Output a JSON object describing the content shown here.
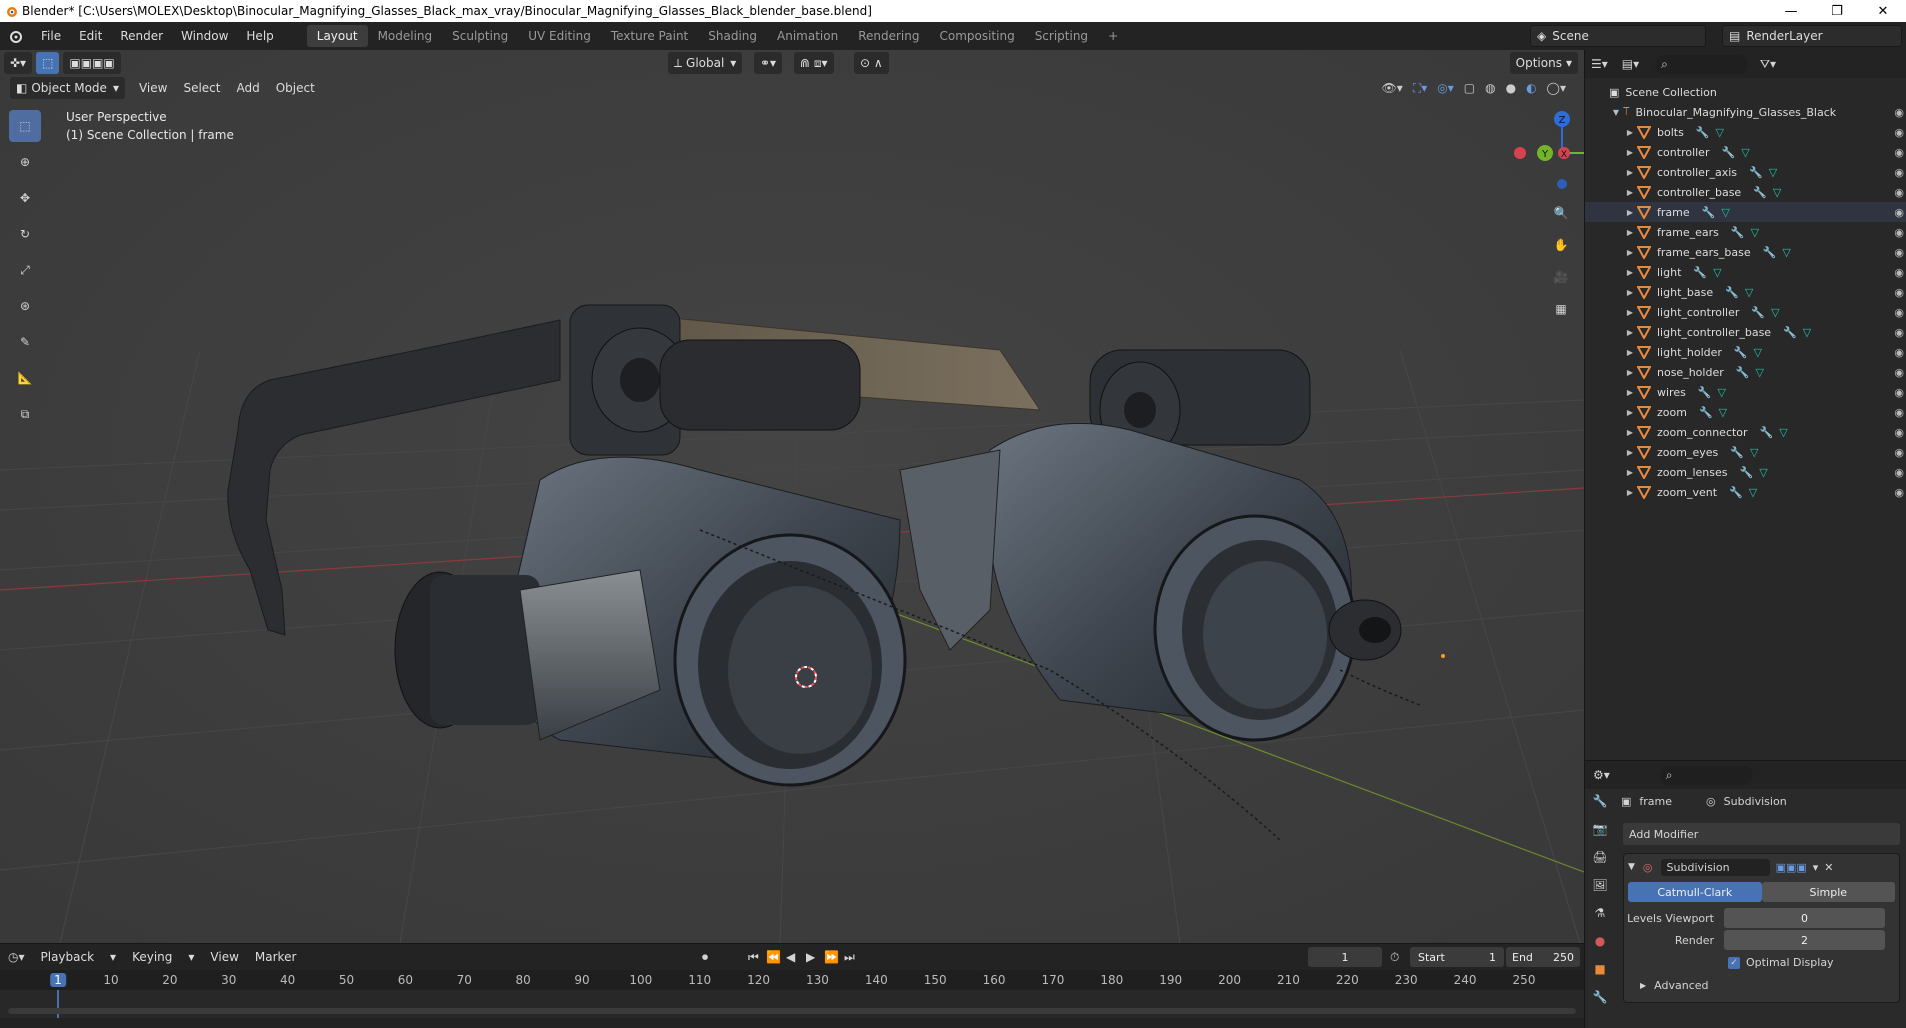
{
  "window": {
    "title": "Blender* [C:\\Users\\MOLEX\\Desktop\\Binocular_Magnifying_Glasses_Black_max_vray/Binocular_Magnifying_Glasses_Black_blender_base.blend]"
  },
  "menubar": {
    "items": [
      "File",
      "Edit",
      "Render",
      "Window",
      "Help"
    ]
  },
  "workspaces": [
    {
      "label": "Layout",
      "active": true
    },
    {
      "label": "Modeling"
    },
    {
      "label": "Sculpting"
    },
    {
      "label": "UV Editing"
    },
    {
      "label": "Texture Paint"
    },
    {
      "label": "Shading"
    },
    {
      "label": "Animation"
    },
    {
      "label": "Rendering"
    },
    {
      "label": "Compositing"
    },
    {
      "label": "Scripting"
    }
  ],
  "scene": {
    "scene_name": "Scene",
    "view_layer": "RenderLayer"
  },
  "viewport": {
    "mode": "Object Mode",
    "menus": [
      "View",
      "Select",
      "Add",
      "Object"
    ],
    "transform_orientation": "Global",
    "options_label": "Options",
    "overlay_line1": "User Perspective",
    "overlay_line2": "(1) Scene Collection | frame"
  },
  "outliner": {
    "root": "Scene Collection",
    "collection": "Binocular_Magnifying_Glasses_Black",
    "objects": [
      "bolts",
      "controller",
      "controller_axis",
      "controller_base",
      "frame",
      "frame_ears",
      "frame_ears_base",
      "light",
      "light_base",
      "light_controller",
      "light_controller_base",
      "light_holder",
      "nose_holder",
      "wires",
      "zoom",
      "zoom_connector",
      "zoom_eyes",
      "zoom_lenses",
      "zoom_vent"
    ]
  },
  "properties": {
    "object": "frame",
    "modifier_crumb": "Subdivision",
    "add_modifier": "Add Modifier",
    "modifier_name": "Subdivision",
    "type_a": "Catmull-Clark",
    "type_b": "Simple",
    "levels_viewport_label": "Levels Viewport",
    "levels_viewport": "0",
    "render_label": "Render",
    "render": "2",
    "optimal_display": "Optimal Display",
    "advanced": "Advanced"
  },
  "timeline": {
    "menus": [
      "Playback",
      "Keying",
      "View",
      "Marker"
    ],
    "current_frame": "1",
    "start_label": "Start",
    "start": "1",
    "end_label": "End",
    "end": "250",
    "ruler": [
      "1",
      "10",
      "20",
      "30",
      "40",
      "50",
      "60",
      "70",
      "80",
      "90",
      "100",
      "110",
      "120",
      "130",
      "140",
      "150",
      "160",
      "170",
      "180",
      "190",
      "200",
      "210",
      "220",
      "230",
      "240",
      "250"
    ]
  },
  "colors": {
    "accent": "#4772b3",
    "mesh_icon": "#e88a3c",
    "modifier_icon": "#6a8fe0",
    "data_icon": "#21c2a6"
  }
}
